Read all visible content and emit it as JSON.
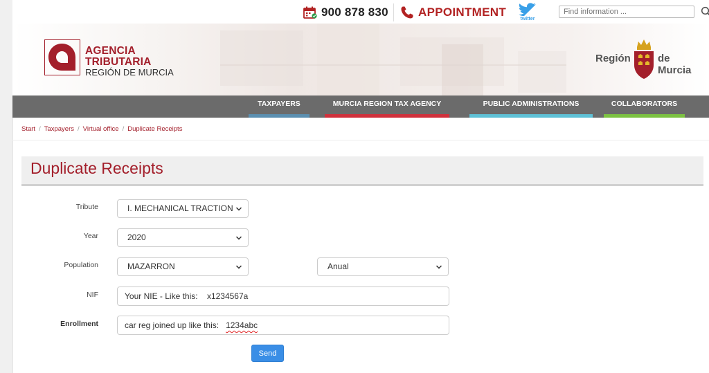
{
  "topbar": {
    "phone_number": "900 878 830",
    "appointment_label": "APPOINTMENT",
    "twitter_label": "twitter",
    "search_placeholder": "Find information ..."
  },
  "logo": {
    "line1": "AGENCIA",
    "line2": "TRIBUTARIA",
    "line3": "REGIÓN DE MURCIA"
  },
  "region_logo": {
    "left_text": "Región",
    "right_text": "de Murcia"
  },
  "nav": [
    {
      "label": "TAXPAYERS",
      "color": "#5b8fb0"
    },
    {
      "label": "MURCIA REGION TAX AGENCY",
      "color": "#d0313c"
    },
    {
      "label": "PUBLIC ADMINISTRATIONS",
      "color": "#5ec1d6"
    },
    {
      "label": "COLLABORATORS",
      "color": "#7cc242"
    }
  ],
  "breadcrumb": [
    "Start",
    "Taxpayers",
    "Virtual office",
    "Duplicate Receipts"
  ],
  "page_title": "Duplicate Receipts",
  "form": {
    "tribute_label": "Tribute",
    "tribute_value": "I. MECHANICAL TRACTION",
    "year_label": "Year",
    "year_value": "2020",
    "population_label": "Population",
    "population_value": "MAZARRON",
    "period_value": "Anual",
    "nif_label": "NIF",
    "nif_value": "Your NIE - Like this:    x1234567a",
    "enrollment_label": "Enrollment",
    "enrollment_value_prefix": "car reg joined up like this:   ",
    "enrollment_value_example": "1234abc",
    "send_label": "Send"
  },
  "colors": {
    "brand": "#a31f2b",
    "nav_bg": "#6b6b6b",
    "send_button": "#3a8ee6"
  }
}
